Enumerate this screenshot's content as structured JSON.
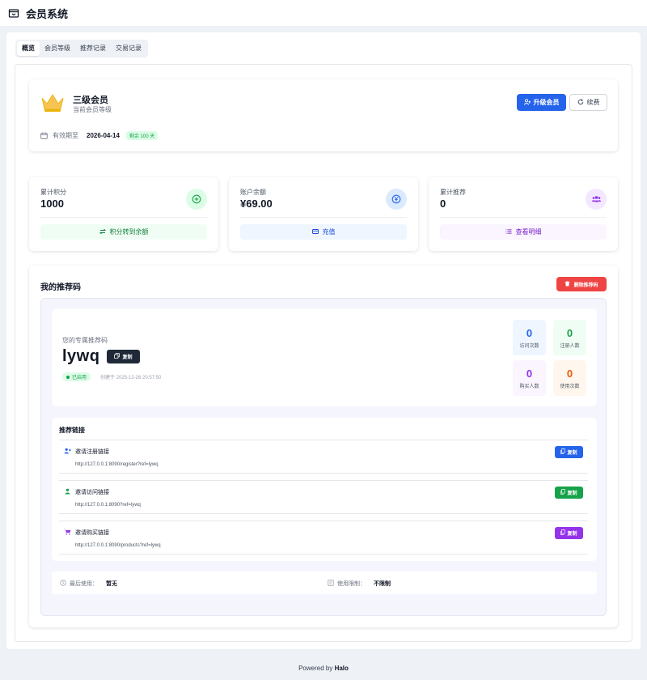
{
  "app": {
    "title": "会员系统"
  },
  "tabs": [
    {
      "label": "概览",
      "active": true
    },
    {
      "label": "会员等级",
      "active": false
    },
    {
      "label": "推荐记录",
      "active": false
    },
    {
      "label": "交易记录",
      "active": false
    }
  ],
  "member": {
    "level": "三级会员",
    "level_caption": "当前会员等级",
    "upgrade_label": "升级会员",
    "refresh_label": "续费",
    "expiry_label": "有效期至",
    "expiry_date": "2026-04-14",
    "remaining": "剩余 100 天"
  },
  "stats": [
    {
      "label": "累计积分",
      "value": "1000",
      "action": "积分转到余额",
      "color": "#16a34a",
      "bg": "#f0fdf4",
      "icon_bg": "#dcfce7",
      "icon": "plus-circle-icon"
    },
    {
      "label": "账户余额",
      "value": "¥69.00",
      "action": "充值",
      "color": "#2563eb",
      "bg": "#eff6ff",
      "icon_bg": "#dbeafe",
      "icon": "yen-icon"
    },
    {
      "label": "累计推荐",
      "value": "0",
      "action": "查看明细",
      "color": "#9333ea",
      "bg": "#faf5ff",
      "icon_bg": "#f3e8ff",
      "icon": "users-icon"
    }
  ],
  "referral": {
    "title": "我的推荐码",
    "clear_label": "删除推荐码",
    "code_caption": "您的专属推荐码",
    "code": "lywq",
    "copy_label": "复制",
    "status": "已启用",
    "created": "创建于 2025-12-26 20:57:50",
    "metrics": [
      {
        "value": "0",
        "label": "访问次数",
        "color": "#2563eb",
        "bg": "#eff6ff"
      },
      {
        "value": "0",
        "label": "注册人数",
        "color": "#16a34a",
        "bg": "#f0fdf4"
      },
      {
        "value": "0",
        "label": "购买人数",
        "color": "#9333ea",
        "bg": "#faf5ff"
      },
      {
        "value": "0",
        "label": "使用次数",
        "color": "#ea580c",
        "bg": "#fff7ed"
      }
    ],
    "links_title": "推荐链接",
    "links": [
      {
        "name": "邀请注册链接",
        "url": "http://127.0.0.1:8090/register?ref=lywq",
        "copy": "复制",
        "color": "#2563eb",
        "icon": "user-plus-icon"
      },
      {
        "name": "邀请访问链接",
        "url": "http://127.0.0.1:8090?ref=lywq",
        "copy": "复制",
        "color": "#16a34a",
        "icon": "user-icon"
      },
      {
        "name": "邀请购买链接",
        "url": "http://127.0.0.1:8090/products?ref=lywq",
        "copy": "复制",
        "color": "#9333ea",
        "icon": "cart-icon"
      }
    ],
    "last_used_label": "最后使用：",
    "last_used_value": "暂无",
    "limit_label": "使用限制：",
    "limit_value": "不限制"
  },
  "footer": {
    "prefix": "Powered by",
    "brand": "Halo"
  }
}
